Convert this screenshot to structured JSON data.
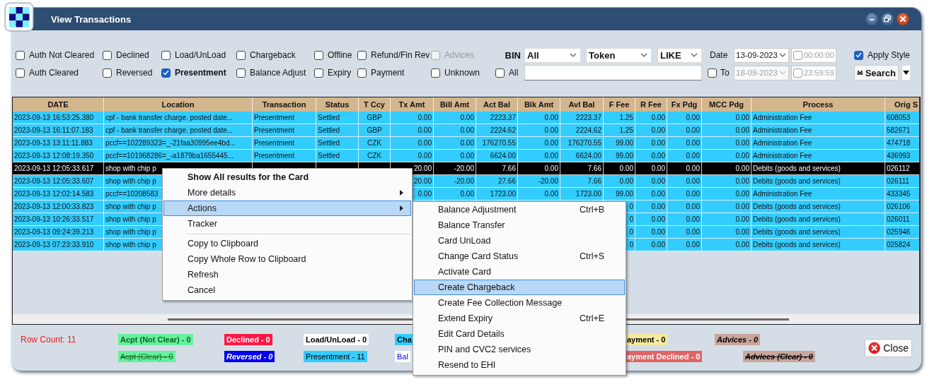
{
  "window": {
    "title": "View Transactions"
  },
  "filters": [
    {
      "label": "Auth Not Cleared",
      "checked": false,
      "disabled": false
    },
    {
      "label": "Declined",
      "checked": false,
      "disabled": false
    },
    {
      "label": "Load/UnLoad",
      "checked": false,
      "disabled": false
    },
    {
      "label": "Chargeback",
      "checked": false,
      "disabled": false
    },
    {
      "label": "Offline",
      "checked": false,
      "disabled": false
    },
    {
      "label": "Refund/Fin Rev",
      "checked": false,
      "disabled": false
    },
    {
      "label": "Advices",
      "checked": false,
      "disabled": true
    },
    {
      "label": "Auth Cleared",
      "checked": false,
      "disabled": false
    },
    {
      "label": "Reversed",
      "checked": false,
      "disabled": false
    },
    {
      "label": "Presentment",
      "checked": true,
      "disabled": false
    },
    {
      "label": "Balance Adjust",
      "checked": false,
      "disabled": false
    },
    {
      "label": "Expiry",
      "checked": false,
      "disabled": false
    },
    {
      "label": "Payment",
      "checked": false,
      "disabled": false
    },
    {
      "label": "Unknown",
      "checked": false,
      "disabled": false
    }
  ],
  "search": {
    "bin_label": "BIN",
    "bin": "All",
    "field": "Token",
    "operator": "LIKE",
    "all": {
      "label": "All",
      "checked": false
    }
  },
  "date_range": {
    "from_label": "Date",
    "from": "13-09-2023",
    "from_time": {
      "value": "00:00:00",
      "checked": false
    },
    "to": {
      "label": "To",
      "checked": false,
      "date": "18-09-2023"
    },
    "to_time": {
      "value": "23:59:59",
      "checked": false
    }
  },
  "apply_style": {
    "label": "Apply Style",
    "checked": true
  },
  "search_button": {
    "label": "Search"
  },
  "table": {
    "columns": [
      "DATE",
      "Location",
      "Transaction",
      "Status",
      "T Ccy",
      "Tx Amt",
      "Bill Amt",
      "Act Bal",
      "Blk Amt",
      "Avl Bal",
      "F Fee",
      "R Fee",
      "Fx Pdg",
      "MCC Pdg",
      "Process",
      "Orig S"
    ],
    "rows": [
      {
        "selected": false,
        "cells": [
          "2023-09-13 16:53:25.380",
          "cpf - bank transfer charge. posted date...",
          "Presentment",
          "Settled",
          "GBP",
          "0.00",
          "0.00",
          "2223.37",
          "0.00",
          "2223.37",
          "1.25",
          "0.00",
          "0.00",
          "0.00",
          "Administration Fee",
          "608053"
        ]
      },
      {
        "selected": false,
        "cells": [
          "2023-09-13 16:11:07.183",
          "cpf - bank transfer charge. posted date...",
          "Presentment",
          "Settled",
          "GBP",
          "0.00",
          "0.00",
          "2224.62",
          "0.00",
          "2224.62",
          "1.25",
          "0.00",
          "0.00",
          "0.00",
          "Administration Fee",
          "582671"
        ]
      },
      {
        "selected": false,
        "cells": [
          "2023-09-13 13:11:11.883",
          "pccf==102289323=_-21faa30995ee4bd...",
          "Presentment",
          "Settled",
          "CZK",
          "0.00",
          "0.00",
          "176270.55",
          "0.00",
          "176270.55",
          "99.00",
          "0.00",
          "0.00",
          "0.00",
          "Administration Fee",
          "474718"
        ]
      },
      {
        "selected": false,
        "cells": [
          "2023-09-13 12:08:19.350",
          "pccf==101968286=_-a1879ba1655445...",
          "Presentment",
          "Settled",
          "CZK",
          "0.00",
          "0.00",
          "6624.00",
          "0.00",
          "6624.00",
          "99.00",
          "0.00",
          "0.00",
          "0.00",
          "Administration Fee",
          "436993"
        ]
      },
      {
        "selected": true,
        "cells": [
          "2023-09-13 12:05:33.617",
          "shop with chip p",
          null,
          null,
          null,
          "20.00",
          "-20.00",
          "7.66",
          "0.00",
          "7.66",
          "0.00",
          "0.00",
          "0.00",
          "0.00",
          "Debits (goods and services)",
          "026112"
        ]
      },
      {
        "selected": false,
        "cells": [
          "2023-09-13 12:05:33.607",
          "shop with chip p",
          null,
          null,
          null,
          "20.00",
          "-20.00",
          "27.66",
          "-20.00",
          "7.66",
          "0.00",
          "0.00",
          "0.00",
          "0.00",
          "Debits (goods and services)",
          "026111"
        ]
      },
      {
        "selected": false,
        "cells": [
          "2023-09-13 12:02:14.583",
          "pccf==10208583",
          null,
          null,
          null,
          "0.00",
          "0.00",
          "1723.00",
          "0.00",
          "1723.00",
          "99.00",
          "0.00",
          "0.00",
          "0.00",
          "Administration Fee",
          "433345"
        ]
      },
      {
        "selected": false,
        "cells": [
          "2023-09-13 12:00:33.823",
          "shop with chip p",
          null,
          null,
          null,
          null,
          null,
          null,
          null,
          null,
          "0",
          "0.00",
          "0.00",
          "0.00",
          "Debits (goods and services)",
          "026106"
        ]
      },
      {
        "selected": false,
        "cells": [
          "2023-09-13 10:26:33.517",
          "shop with chip p",
          null,
          null,
          null,
          null,
          null,
          null,
          null,
          null,
          "0",
          "0.00",
          "0.00",
          "0.00",
          "Debits (goods and services)",
          "026011"
        ]
      },
      {
        "selected": false,
        "cells": [
          "2023-09-13 09:24:39.213",
          "shop with chip p",
          null,
          null,
          null,
          null,
          null,
          null,
          null,
          null,
          "0",
          "0.00",
          "0.00",
          "0.00",
          "Debits (goods and services)",
          "025946"
        ]
      },
      {
        "selected": false,
        "cells": [
          "2023-09-13 07:23:33.910",
          "shop with chip p",
          null,
          null,
          null,
          null,
          null,
          null,
          null,
          null,
          "0",
          "0.00",
          "0.00",
          "0.00",
          "Debits (goods and services)",
          "025824"
        ]
      }
    ]
  },
  "footer": {
    "row_count": "Row Count: 11",
    "legend": [
      {
        "label": "Acpt (Not Clear) - 0",
        "color": "#66f0a0",
        "kind": "bold"
      },
      {
        "label": "Declined - 0",
        "color": "#ff1744",
        "kind": "bold"
      },
      {
        "label": "Load/UnLoad - 0",
        "color": "#ffffff",
        "kind": "bold"
      },
      {
        "label": "Cha",
        "color": "#33ccff",
        "kind": "bold"
      },
      {
        "label": "ayment - 0",
        "color": "#f5eba0",
        "kind": "bold"
      },
      {
        "label": "Advices - 0",
        "color": "#c9a59c",
        "kind": "bold-italic"
      },
      {
        "label": "Acpt (Clear) - 0",
        "color": "#66f0a0",
        "kind": "strike"
      },
      {
        "label": "Reversed - 0",
        "color": "#0000ee",
        "kind": "bold-italic"
      },
      {
        "label": "Presentment - 11",
        "color": "#33ccff",
        "kind": "plain"
      },
      {
        "label": "Bal",
        "color": "#ffffff",
        "kind": "link"
      },
      {
        "label": "ayment Declined - 0",
        "color": "#e06464",
        "kind": "bold"
      },
      {
        "label": "Advices (Clear) - 0",
        "color": "#c9a59c",
        "kind": "bold-italic-strike"
      }
    ],
    "close_button": {
      "label": "Close"
    }
  },
  "context_menu": {
    "items": [
      {
        "kind": "default",
        "label": "Show All results for the Card",
        "selected": false
      },
      {
        "kind": "submenu",
        "label": "More details",
        "selected": false
      },
      {
        "kind": "submenu",
        "label": "Actions",
        "selected": true
      },
      {
        "kind": "item",
        "label": "Tracker",
        "selected": false
      },
      {
        "kind": "separator"
      },
      {
        "kind": "item",
        "label": "Copy to Clipboard",
        "selected": false
      },
      {
        "kind": "item",
        "label": "Copy Whole Row to Clipboard",
        "selected": false
      },
      {
        "kind": "item",
        "label": "Refresh",
        "selected": false
      },
      {
        "kind": "item",
        "label": "Cancel",
        "selected": false
      }
    ]
  },
  "submenu": {
    "items": [
      {
        "label": "Balance Adjustment",
        "shortcut": "Ctrl+B",
        "selected": false
      },
      {
        "label": "Balance Transfer",
        "selected": false
      },
      {
        "label": "Card UnLoad",
        "selected": false
      },
      {
        "label": "Change Card Status",
        "shortcut": "Ctrl+S",
        "selected": false
      },
      {
        "label": "Activate Card",
        "selected": false
      },
      {
        "label": "Create Chargeback",
        "selected": true
      },
      {
        "label": "Create Fee Collection Message",
        "selected": false
      },
      {
        "label": "Extend Expiry",
        "shortcut": "Ctrl+E",
        "selected": false
      },
      {
        "label": "Edit Card Details",
        "selected": false
      },
      {
        "label": "PIN and CVC2 services",
        "selected": false
      },
      {
        "label": "Resend to EHI",
        "selected": false
      }
    ]
  }
}
